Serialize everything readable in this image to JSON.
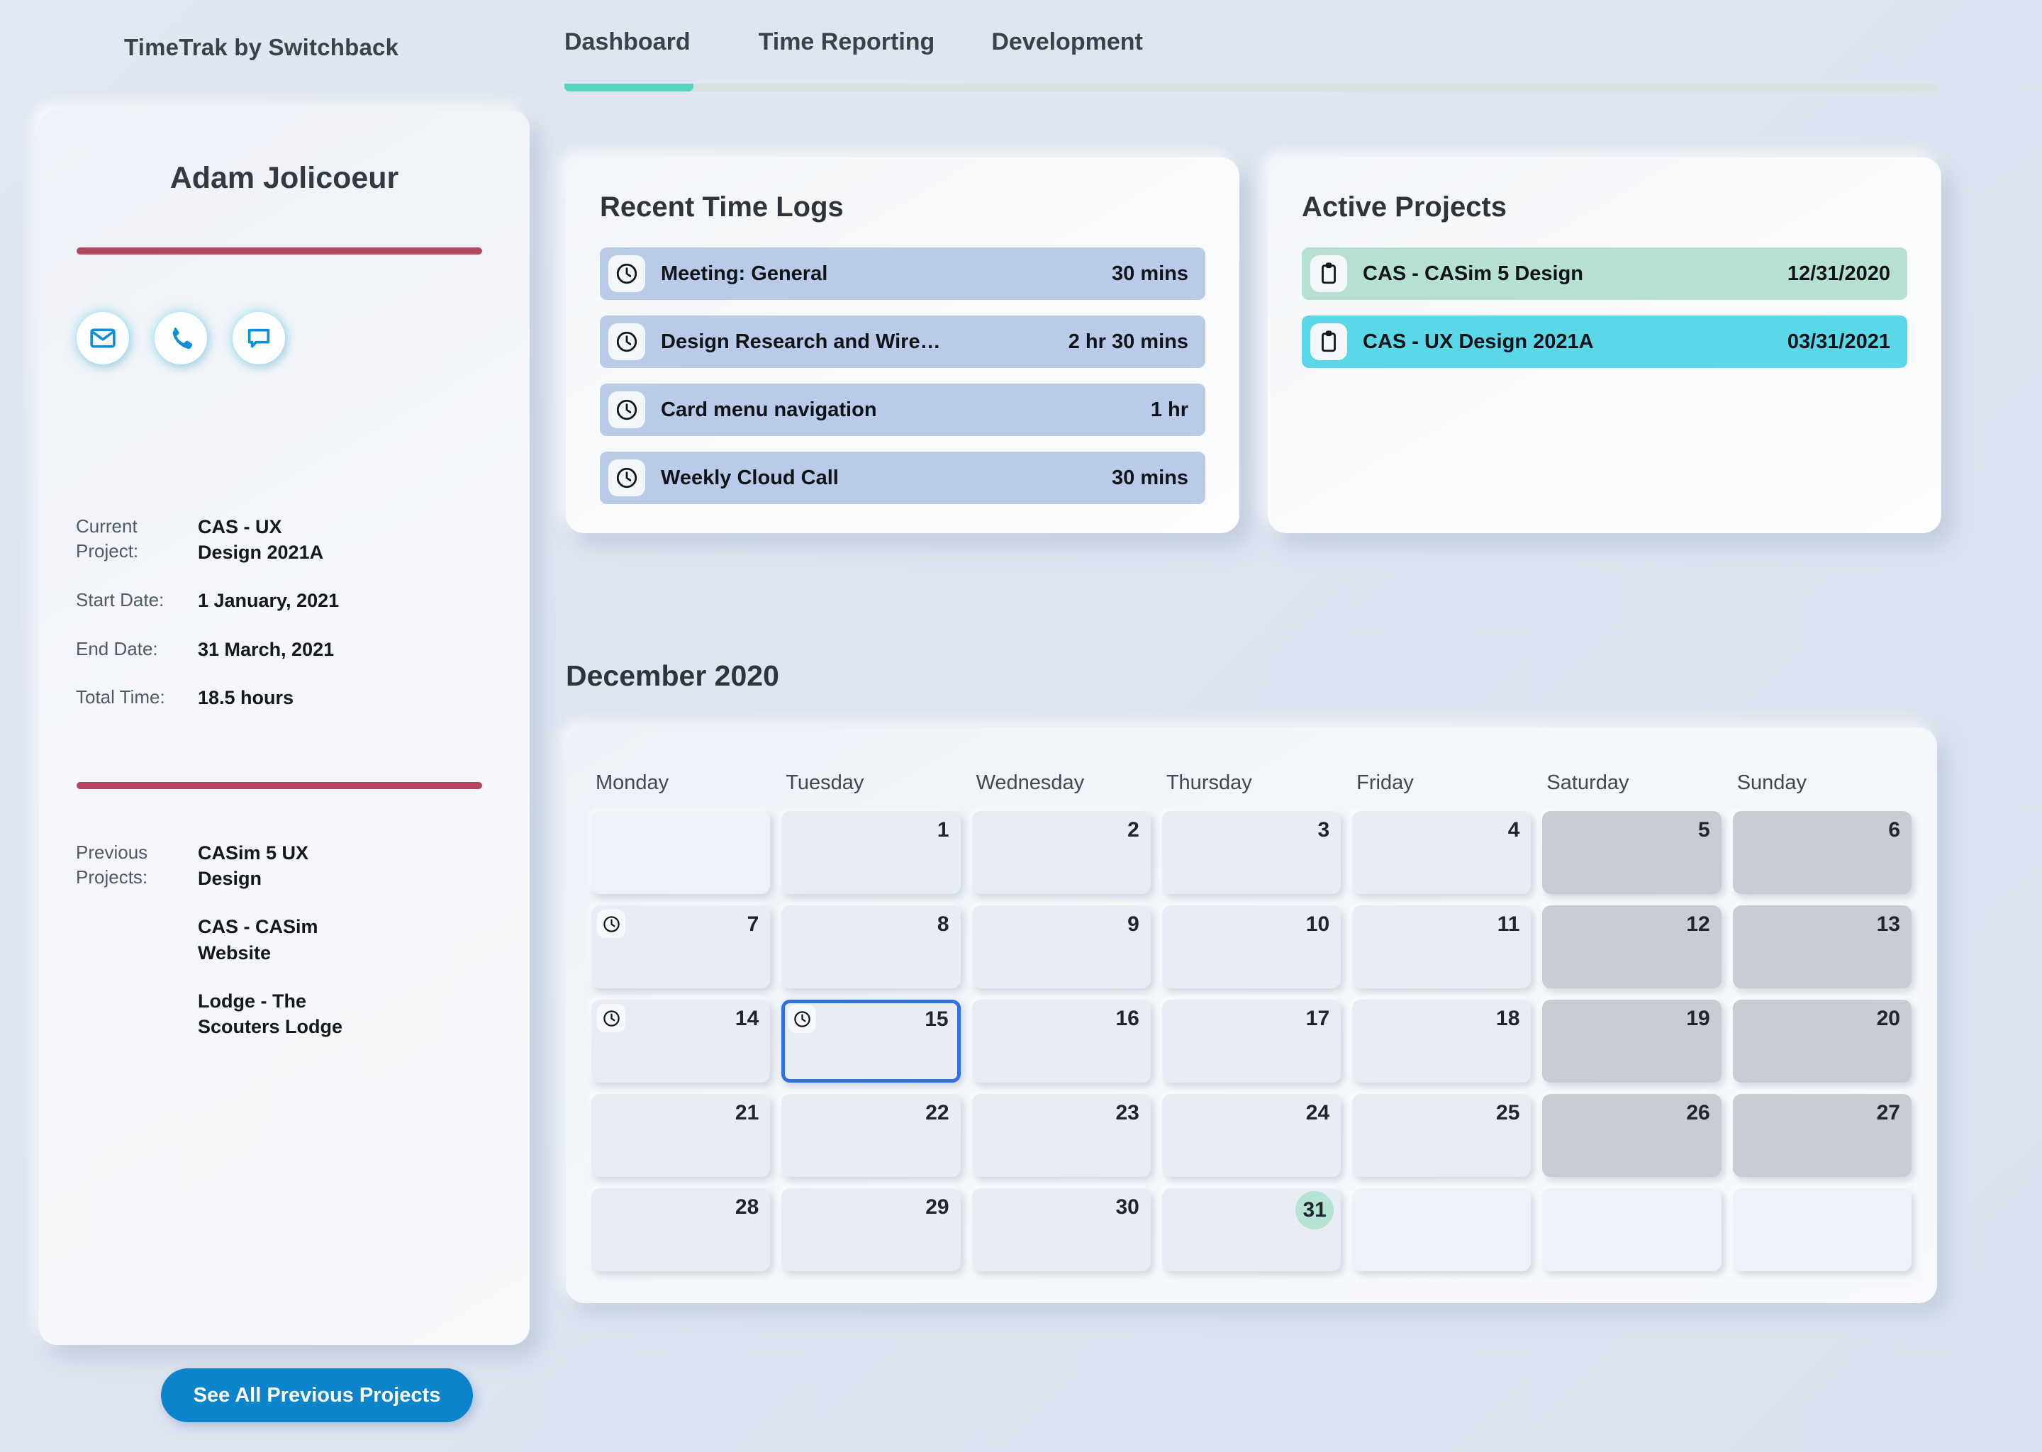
{
  "header": {
    "brand": "TimeTrak by Switchback",
    "nav": [
      {
        "label": "Dashboard",
        "active": true
      },
      {
        "label": "Time Reporting",
        "active": false
      },
      {
        "label": "Development",
        "active": false
      }
    ],
    "accent_active": "#54d4bb"
  },
  "sidebar": {
    "profile_name": "Adam Jolicoeur",
    "divider_color": "#b4475e",
    "contacts": [
      {
        "icon": "mail-icon"
      },
      {
        "icon": "phone-icon"
      },
      {
        "icon": "chat-icon"
      }
    ],
    "details": [
      {
        "label": "Current Project:",
        "value": "CAS - UX Design 2021A"
      },
      {
        "label": "Start Date:",
        "value": "1 January, 2021"
      },
      {
        "label": "End Date:",
        "value": "31 March, 2021"
      },
      {
        "label": "Total Time:",
        "value": "18.5 hours"
      }
    ],
    "previous_label": "Previous Projects:",
    "previous_projects": [
      "CASim 5 UX Design",
      "CAS - CASim Website",
      "Lodge - The Scouters Lodge"
    ],
    "see_all_label": "See All Previous Projects",
    "see_all_color": "#0c84cc"
  },
  "time_logs": {
    "title": "Recent Time Logs",
    "row_color": "#b9cbe8",
    "items": [
      {
        "icon": "clock-icon",
        "label": "Meeting: General",
        "duration": "30 mins"
      },
      {
        "icon": "clock-icon",
        "label": "Design Research and Wire…",
        "duration": "2 hr 30 mins"
      },
      {
        "icon": "clock-icon",
        "label": "Card menu navigation",
        "duration": "1 hr"
      },
      {
        "icon": "clock-icon",
        "label": "Weekly Cloud Call",
        "duration": "30 mins"
      }
    ]
  },
  "active_projects": {
    "title": "Active Projects",
    "items": [
      {
        "icon": "clipboard-icon",
        "label": "CAS - CASim 5 Design",
        "date": "12/31/2020",
        "color": "#b5e0d2"
      },
      {
        "icon": "clipboard-icon",
        "label": "CAS - UX Design 2021A",
        "date": "03/31/2021",
        "color": "#5bd8e8"
      }
    ]
  },
  "calendar": {
    "title": "December 2020",
    "day_headers": [
      "Monday",
      "Tuesday",
      "Wednesday",
      "Thursday",
      "Friday",
      "Saturday",
      "Sunday"
    ],
    "selected_day": 15,
    "selected_border_color": "#3071dd",
    "today_badge_day": 31,
    "today_badge_color": "#b6e3d4",
    "weekend_color": "#c9cdd3",
    "days_with_logs": [
      7,
      14,
      15
    ],
    "weeks": [
      [
        null,
        1,
        2,
        3,
        4,
        5,
        6
      ],
      [
        7,
        8,
        9,
        10,
        11,
        12,
        13
      ],
      [
        14,
        15,
        16,
        17,
        18,
        19,
        20
      ],
      [
        21,
        22,
        23,
        24,
        25,
        26,
        27
      ],
      [
        28,
        29,
        30,
        31,
        null,
        null,
        null
      ]
    ]
  }
}
